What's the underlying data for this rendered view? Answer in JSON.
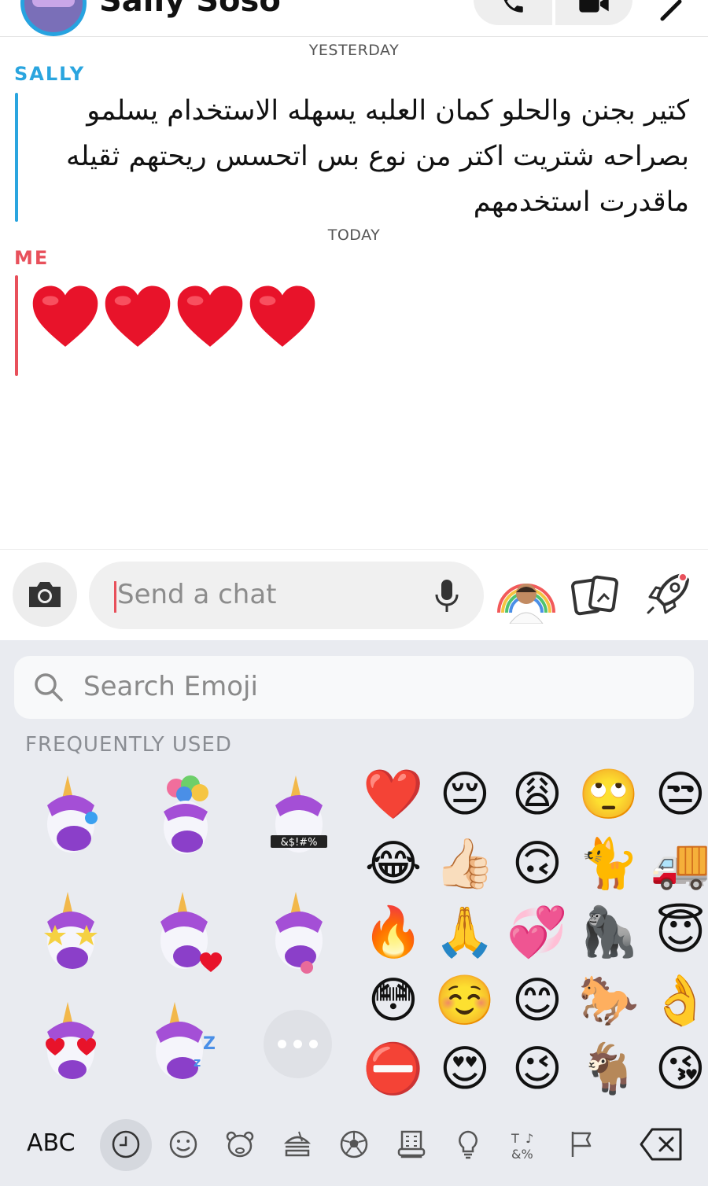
{
  "header": {
    "contact_name": "Sally Soso",
    "call_icon": "phone-icon",
    "video_icon": "video-camera-icon",
    "more_icon": "chevron-icon"
  },
  "messages": {
    "day1": "YESTERDAY",
    "sender1": "SALLY",
    "text1": "كتير بجنن والحلو كمان العلبه يسهله الاستخدام يسلمو بصراحه شتريت اكتر من نوع بس اتحسس ريحتهم ثقيله ماقدرت استخدمهم",
    "day2": "TODAY",
    "sender2": "ME",
    "hearts": "❤️❤️❤️❤️"
  },
  "input_bar": {
    "placeholder": "Send a chat"
  },
  "keyboard": {
    "search_placeholder": "Search Emoji",
    "section_title": "FREQUENTLY USED",
    "sticker_labels": [
      "&$!#%"
    ],
    "emojis": [
      [
        "❤️",
        "😔",
        "😩",
        "🙄",
        "😒"
      ],
      [
        "😂",
        "👍🏻",
        "🙃",
        "🐈",
        "🚚"
      ],
      [
        "🔥",
        "🙏",
        "💞",
        "🦍",
        "😇"
      ],
      [
        "😳",
        "☺️",
        "😊",
        "🐎",
        "👌"
      ],
      [
        "⛔",
        "😍",
        "😉",
        "🐐",
        "😘"
      ]
    ],
    "abc_label": "ABC"
  },
  "colors": {
    "sally": "#2aa5df",
    "me": "#e8505b",
    "keyboard_bg": "#e9ebf0"
  }
}
